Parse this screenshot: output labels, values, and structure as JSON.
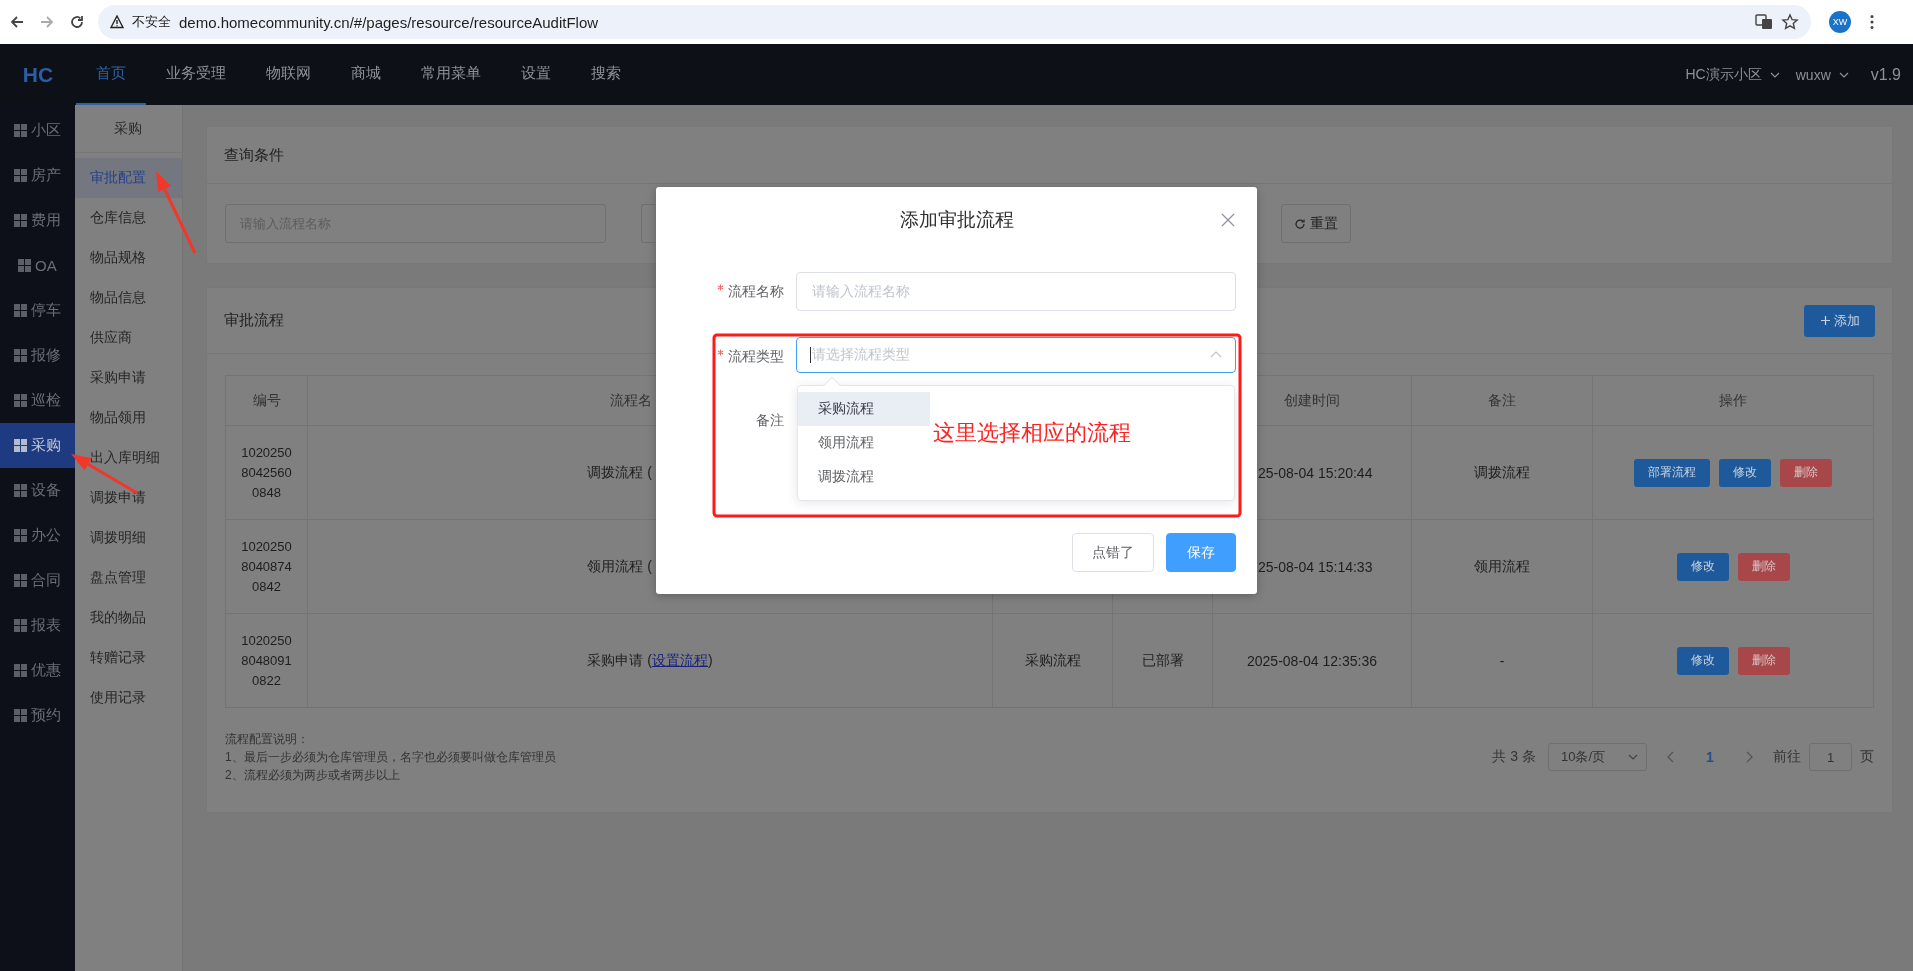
{
  "browser": {
    "security_label": "不安全",
    "url": "demo.homecommunity.cn/#/pages/resource/resourceAuditFlow",
    "avatar": "XW"
  },
  "topnav": {
    "logo": "HC",
    "items": [
      {
        "label": "首页",
        "selected": true
      },
      {
        "label": "业务受理",
        "selected": false
      },
      {
        "label": "物联网",
        "selected": false
      },
      {
        "label": "商城",
        "selected": false
      },
      {
        "label": "常用菜单",
        "selected": false
      },
      {
        "label": "设置",
        "selected": false
      },
      {
        "label": "搜索",
        "selected": false
      }
    ],
    "community": "HC演示小区",
    "user": "wuxw",
    "version": "v1.9"
  },
  "sidebar": {
    "items": [
      {
        "label": "小区",
        "selected": false
      },
      {
        "label": "房产",
        "selected": false
      },
      {
        "label": "费用",
        "selected": false
      },
      {
        "label": "OA",
        "selected": false
      },
      {
        "label": "停车",
        "selected": false
      },
      {
        "label": "报修",
        "selected": false
      },
      {
        "label": "巡检",
        "selected": false
      },
      {
        "label": "采购",
        "selected": true
      },
      {
        "label": "设备",
        "selected": false
      },
      {
        "label": "办公",
        "selected": false
      },
      {
        "label": "合同",
        "selected": false
      },
      {
        "label": "报表",
        "selected": false
      },
      {
        "label": "优惠",
        "selected": false
      },
      {
        "label": "预约",
        "selected": false
      }
    ]
  },
  "submenu": {
    "title": "采购",
    "items": [
      {
        "label": "审批配置",
        "selected": true
      },
      {
        "label": "仓库信息",
        "selected": false
      },
      {
        "label": "物品规格",
        "selected": false
      },
      {
        "label": "物品信息",
        "selected": false
      },
      {
        "label": "供应商",
        "selected": false
      },
      {
        "label": "采购申请",
        "selected": false
      },
      {
        "label": "物品领用",
        "selected": false
      },
      {
        "label": "出入库明细",
        "selected": false
      },
      {
        "label": "调拨申请",
        "selected": false
      },
      {
        "label": "调拨明细",
        "selected": false
      },
      {
        "label": "盘点管理",
        "selected": false
      },
      {
        "label": "我的物品",
        "selected": false
      },
      {
        "label": "转赠记录",
        "selected": false
      },
      {
        "label": "使用记录",
        "selected": false
      }
    ]
  },
  "query": {
    "title": "查询条件",
    "name_placeholder": "请输入流程名称",
    "reset_button": "重置"
  },
  "flows": {
    "title": "审批流程",
    "add_button": "添加",
    "columns": [
      "编号",
      "流程名",
      "创建时间",
      "备注",
      "操作"
    ],
    "rows": [
      {
        "id": "102025080425600848",
        "name_prefix": "调拨流程 (",
        "created": "25-08-04 15:20:44",
        "remark": "调拨流程",
        "actions": [
          {
            "label": "部署流程",
            "kind": "primary"
          },
          {
            "label": "修改",
            "kind": "primary"
          },
          {
            "label": "删除",
            "kind": "danger"
          }
        ]
      },
      {
        "id": "102025080408740842",
        "name_prefix": "领用流程 (",
        "created": "25-08-04 15:14:33",
        "remark": "领用流程",
        "actions": [
          {
            "label": "修改",
            "kind": "primary"
          },
          {
            "label": "删除",
            "kind": "danger"
          }
        ]
      },
      {
        "id": "102025080480910822",
        "name_prefix": "采购申请 (",
        "link": "设置流程",
        "name_suffix": ")",
        "type": "采购流程",
        "status": "已部署",
        "created": "2025-08-04 12:35:36",
        "remark": "-",
        "actions": [
          {
            "label": "修改",
            "kind": "primary"
          },
          {
            "label": "删除",
            "kind": "danger"
          }
        ]
      }
    ],
    "notes": [
      "流程配置说明：",
      "1、最后一步必须为仓库管理员，名字也必须要叫做仓库管理员",
      "2、流程必须为两步或者两步以上"
    ],
    "pagination": {
      "total": "共 3 条",
      "page_size": "10条/页",
      "pages": [
        {
          "label": "1",
          "selected": true
        }
      ],
      "goto_label": "前往",
      "goto_value": "1",
      "page_unit": "页"
    }
  },
  "dialog": {
    "title": "添加审批流程",
    "fields": [
      {
        "label": "流程名称",
        "required": true,
        "placeholder": "请输入流程名称",
        "kind": "input"
      },
      {
        "label": "流程类型",
        "required": true,
        "placeholder": "请选择流程类型",
        "kind": "select"
      },
      {
        "label": "备注",
        "required": false,
        "kind": "textarea"
      }
    ],
    "options": [
      {
        "label": "采购流程",
        "highlighted": true
      },
      {
        "label": "领用流程",
        "highlighted": false
      },
      {
        "label": "调拨流程",
        "highlighted": false
      }
    ],
    "buttons": [
      {
        "label": "点错了",
        "kind": "default"
      },
      {
        "label": "保存",
        "kind": "primary"
      }
    ]
  },
  "annotation": {
    "text": "这里选择相应的流程"
  }
}
